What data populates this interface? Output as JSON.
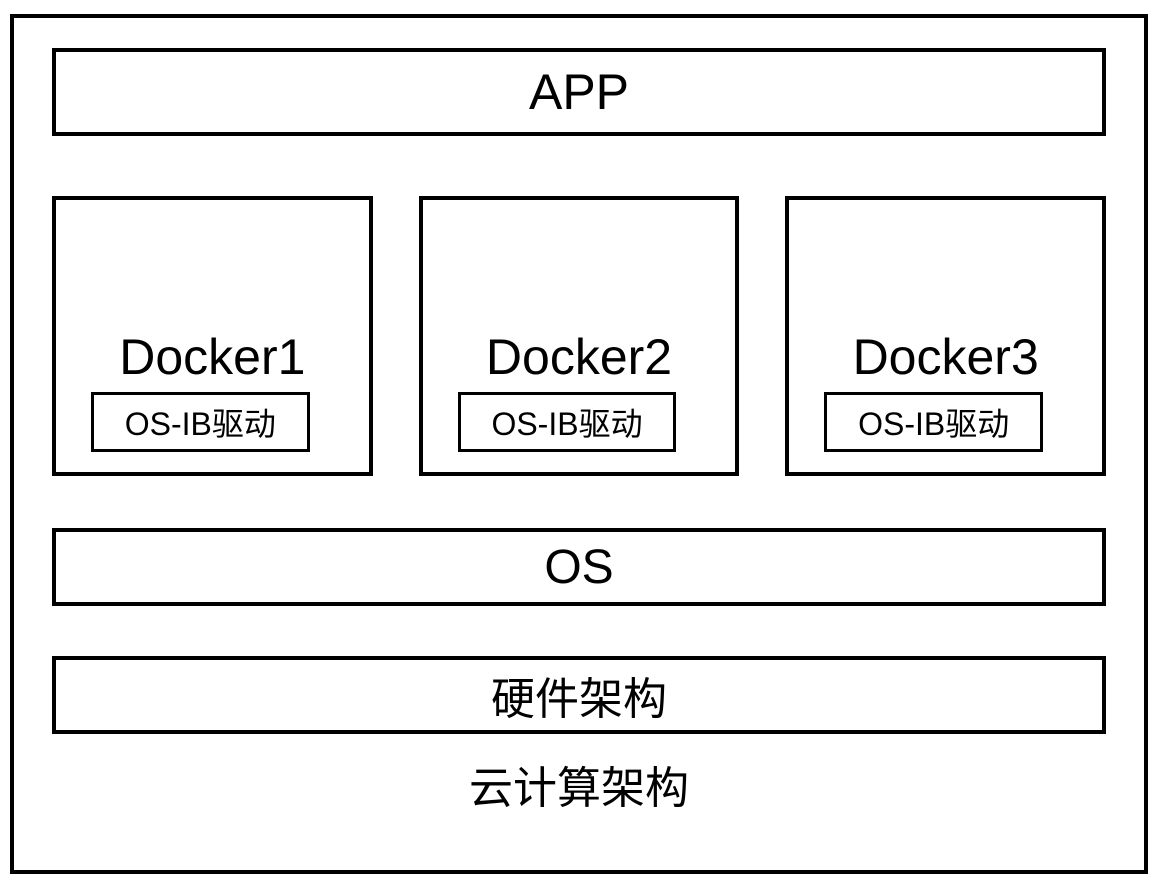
{
  "layers": {
    "app": "APP",
    "os": "OS",
    "hardware": "硬件架构",
    "cloud": "云计算架构"
  },
  "dockers": [
    {
      "title": "Docker1",
      "driver": "OS-IB驱动"
    },
    {
      "title": "Docker2",
      "driver": "OS-IB驱动"
    },
    {
      "title": "Docker3",
      "driver": "OS-IB驱动"
    }
  ]
}
